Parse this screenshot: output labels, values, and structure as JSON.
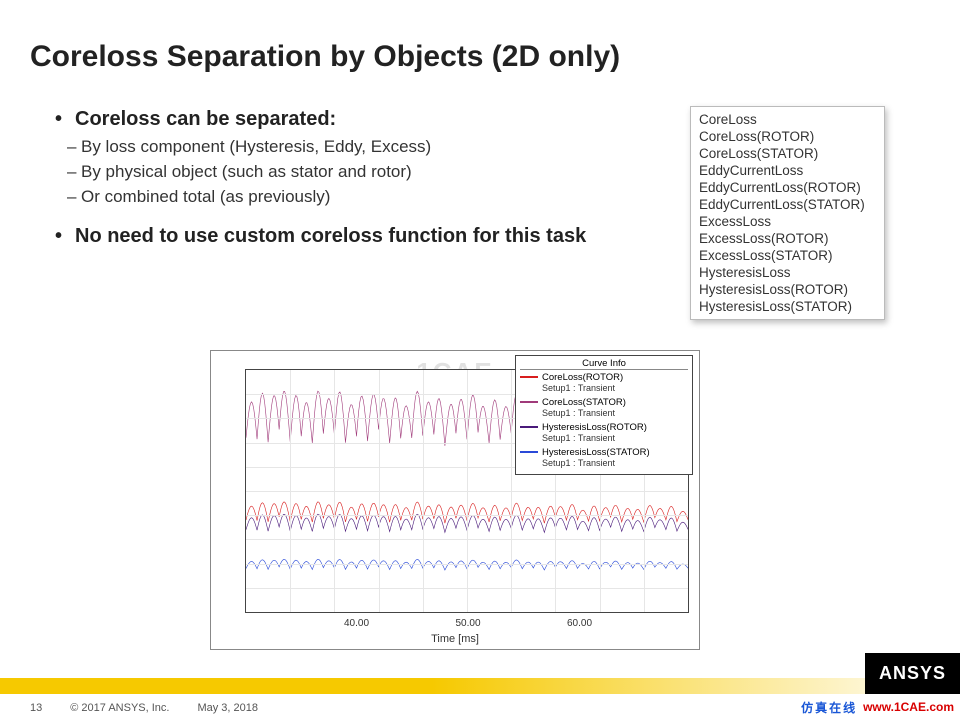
{
  "title": "Coreloss Separation by Objects (2D only)",
  "bullets": {
    "b1": "Coreloss can be separated:",
    "s1": "By loss component (Hysteresis, Eddy, Excess)",
    "s2": "By physical object (such as stator and rotor)",
    "s3": "Or combined total (as previously)",
    "b2": "No need to use custom coreloss function for this task"
  },
  "listbox": [
    "CoreLoss",
    "CoreLoss(ROTOR)",
    "CoreLoss(STATOR)",
    "EddyCurrentLoss",
    "EddyCurrentLoss(ROTOR)",
    "EddyCurrentLoss(STATOR)",
    "ExcessLoss",
    "ExcessLoss(ROTOR)",
    "ExcessLoss(STATOR)",
    "HysteresisLoss",
    "HysteresisLoss(ROTOR)",
    "HysteresisLoss(STATOR)"
  ],
  "chart_data": {
    "type": "line",
    "title": "Curve Info",
    "xlabel": "Time [ms]",
    "xticks": [
      40.0,
      50.0,
      60.0
    ],
    "xlim": [
      30,
      70
    ],
    "series": [
      {
        "name": "CoreLoss(ROTOR)",
        "setup": "Setup1 : Transient",
        "color": "#d81e1e",
        "baseline": 0.62,
        "amplitude": 0.07
      },
      {
        "name": "CoreLoss(STATOR)",
        "setup": "Setup1 : Transient",
        "color": "#a03a7a",
        "baseline": 0.28,
        "amplitude": 0.18
      },
      {
        "name": "HysteresisLoss(ROTOR)",
        "setup": "Setup1 : Transient",
        "color": "#4a1a7a",
        "baseline": 0.66,
        "amplitude": 0.06
      },
      {
        "name": "HysteresisLoss(STATOR)",
        "setup": "Setup1 : Transient",
        "color": "#2a4ad8",
        "baseline": 0.82,
        "amplitude": 0.035
      }
    ]
  },
  "watermark": "1CAE",
  "footer": {
    "page": "13",
    "copyright": "© 2017 ANSYS, Inc.",
    "date": "May 3, 2018"
  },
  "brand": {
    "logo": "ANSYS",
    "cae_cn": "仿真在线",
    "cae_url": "www.1CAE.com"
  }
}
